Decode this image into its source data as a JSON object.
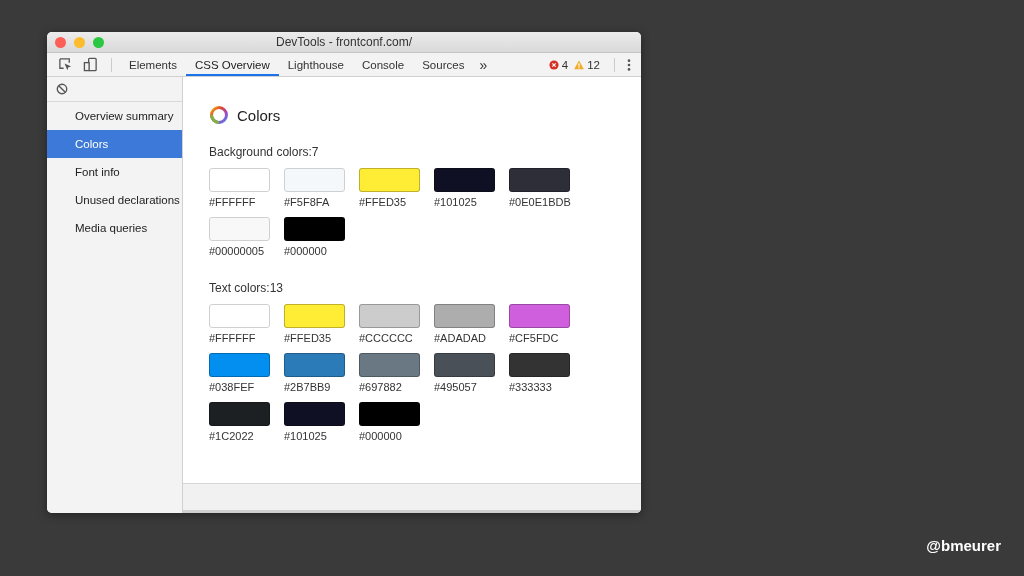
{
  "window": {
    "title": "DevTools - frontconf.com/"
  },
  "tabs": [
    {
      "label": "Elements",
      "selected": false
    },
    {
      "label": "CSS Overview",
      "selected": true
    },
    {
      "label": "Lighthouse",
      "selected": false
    },
    {
      "label": "Console",
      "selected": false
    },
    {
      "label": "Sources",
      "selected": false
    }
  ],
  "more_tabs": "»",
  "issues": {
    "errors": "4",
    "warnings": "12"
  },
  "sidebar": {
    "items": [
      {
        "label": "Overview summary",
        "selected": false
      },
      {
        "label": "Colors",
        "selected": true
      },
      {
        "label": "Font info",
        "selected": false
      },
      {
        "label": "Unused declarations",
        "selected": false
      },
      {
        "label": "Media queries",
        "selected": false
      }
    ]
  },
  "panel": {
    "title": "Colors",
    "sections": [
      {
        "heading": "Background colors:7",
        "swatches": [
          {
            "color": "#ffffff",
            "label": "#FFFFFF"
          },
          {
            "color": "#f5f8fa",
            "label": "#F5F8FA"
          },
          {
            "color": "#ffed35",
            "label": "#FFED35"
          },
          {
            "color": "#101025",
            "label": "#101025"
          },
          {
            "color": "#2e2e39",
            "label": "#0E0E1BDB"
          },
          {
            "color": "#f8f8f8",
            "label": "#00000005"
          },
          {
            "color": "#000000",
            "label": "#000000"
          }
        ]
      },
      {
        "heading": "Text colors:13",
        "swatches": [
          {
            "color": "#ffffff",
            "label": "#FFFFFF"
          },
          {
            "color": "#ffed35",
            "label": "#FFED35"
          },
          {
            "color": "#cccccc",
            "label": "#CCCCCC"
          },
          {
            "color": "#adadad",
            "label": "#ADADAD"
          },
          {
            "color": "#cf5fdc",
            "label": "#CF5FDC"
          },
          {
            "color": "#038fef",
            "label": "#038FEF"
          },
          {
            "color": "#2b7bb9",
            "label": "#2B7BB9"
          },
          {
            "color": "#697882",
            "label": "#697882"
          },
          {
            "color": "#495057",
            "label": "#495057"
          },
          {
            "color": "#333333",
            "label": "#333333"
          },
          {
            "color": "#1c2022",
            "label": "#1C2022"
          },
          {
            "color": "#101025",
            "label": "#101025"
          },
          {
            "color": "#000000",
            "label": "#000000"
          }
        ]
      }
    ]
  },
  "credit": "@bmeurer"
}
